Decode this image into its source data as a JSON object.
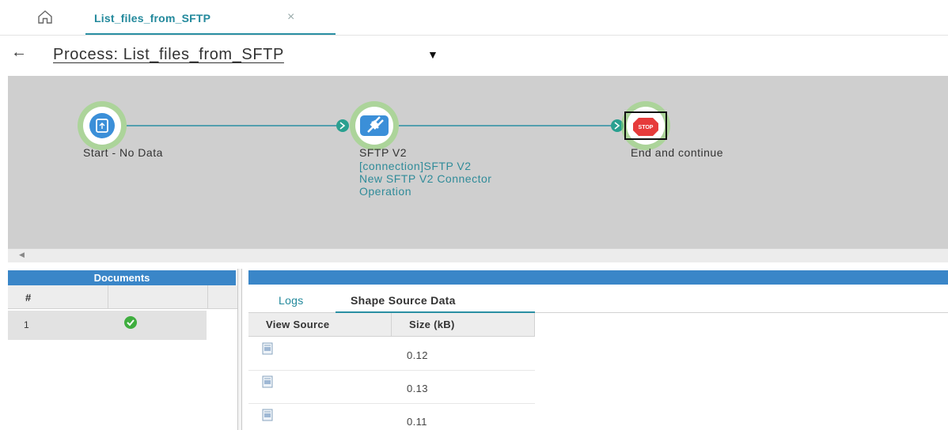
{
  "top_tabs": [
    {
      "label": "List_files_from_SFTP",
      "close": "×"
    }
  ],
  "process": {
    "back": "←",
    "title": "Process: List_files_from_SFTP",
    "caret": "▼"
  },
  "canvas": {
    "nodes": [
      {
        "label": "Start - No Data",
        "icon": "start-icon",
        "color": "#3b8fd8"
      },
      {
        "label": "SFTP V2",
        "sub_lines": [
          "[connection]SFTP V2",
          "New SFTP V2 Connector",
          "Operation"
        ],
        "icon": "plug-icon",
        "color": "#3b8fd8"
      },
      {
        "label": "End and continue",
        "icon": "stop-icon",
        "badge": "STOP",
        "color": "#e63b3b"
      }
    ],
    "accent": "#2a8fa3",
    "halo": "#7fd25f",
    "connector_badge": "›"
  },
  "scroll": {
    "left_arrow": "◀"
  },
  "documents": {
    "header": "Documents",
    "col_hash": "#",
    "rows": [
      {
        "num": "1",
        "status": "success"
      }
    ]
  },
  "source": {
    "tabs": [
      "Logs",
      "Shape Source Data"
    ],
    "active_tab": "Shape Source Data",
    "columns": [
      "View Source",
      "Size (kB)"
    ],
    "rows": [
      {
        "size": "0.12"
      },
      {
        "size": "0.13"
      },
      {
        "size": "0.11"
      }
    ]
  },
  "colors": {
    "panel_header": "#3a86c8",
    "tab_text": "#23899c",
    "canvas_bg": "#cfcfcf"
  }
}
